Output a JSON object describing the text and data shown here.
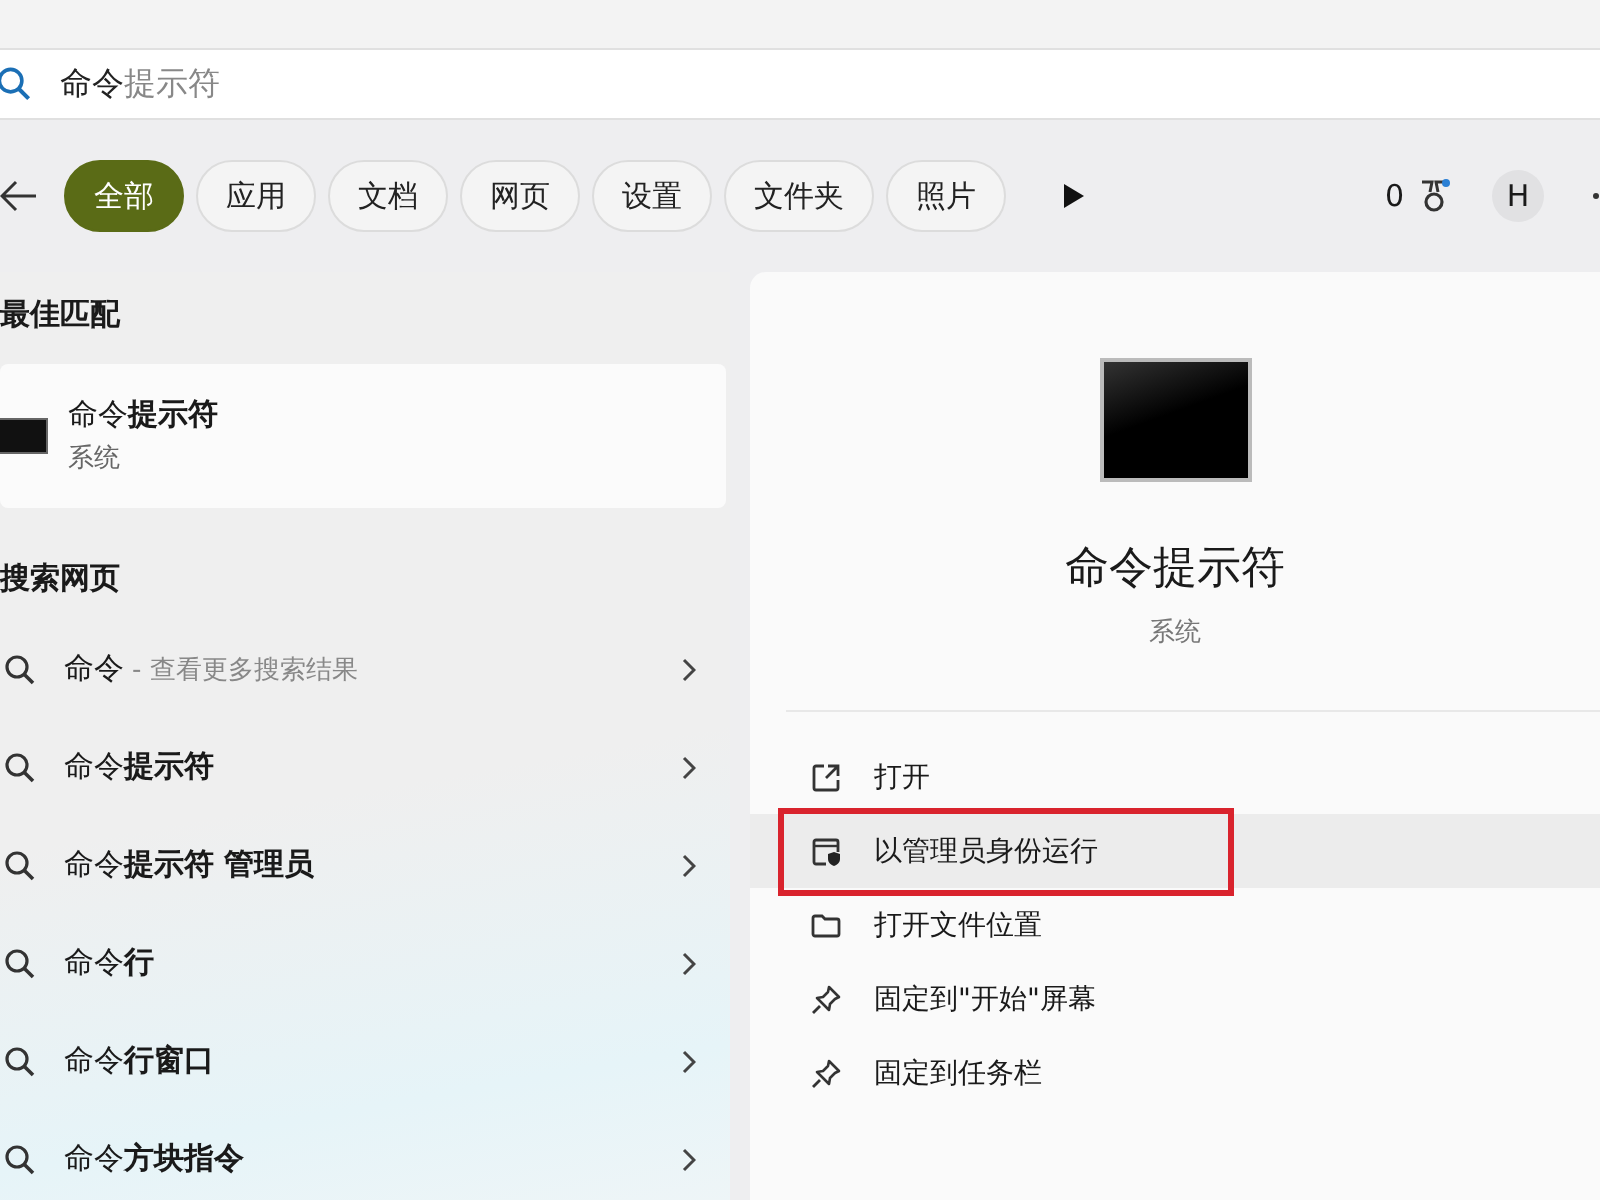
{
  "search": {
    "value": "命令",
    "completion": "提示符"
  },
  "filters": [
    {
      "label": "全部",
      "selected": true
    },
    {
      "label": "应用",
      "selected": false
    },
    {
      "label": "文档",
      "selected": false
    },
    {
      "label": "网页",
      "selected": false
    },
    {
      "label": "设置",
      "selected": false
    },
    {
      "label": "文件夹",
      "selected": false
    },
    {
      "label": "照片",
      "selected": false
    }
  ],
  "points": "0",
  "avatar": "H",
  "best_match": {
    "heading": "最佳匹配",
    "title": "命令**提示符**",
    "subtitle": "系统"
  },
  "web": {
    "heading": "搜索网页",
    "items": [
      {
        "text": "命令",
        "hint": "- 查看更多搜索结果"
      },
      {
        "text": "命令**提示符**"
      },
      {
        "text": "命令**提示符 管理员**"
      },
      {
        "text": "命令**行**"
      },
      {
        "text": "命令**行窗口**"
      },
      {
        "text": "命令**方块指令**"
      }
    ]
  },
  "detail": {
    "title": "命令提示符",
    "subtitle": "系统",
    "actions": [
      {
        "kind": "open",
        "label": "打开",
        "highlighted": false
      },
      {
        "kind": "admin",
        "label": "以管理员身份运行",
        "highlighted": true
      },
      {
        "kind": "folder",
        "label": "打开文件位置",
        "highlighted": false
      },
      {
        "kind": "pin",
        "label": "固定到\"开始\"屏幕",
        "highlighted": false
      },
      {
        "kind": "pin",
        "label": "固定到任务栏",
        "highlighted": false
      }
    ]
  }
}
